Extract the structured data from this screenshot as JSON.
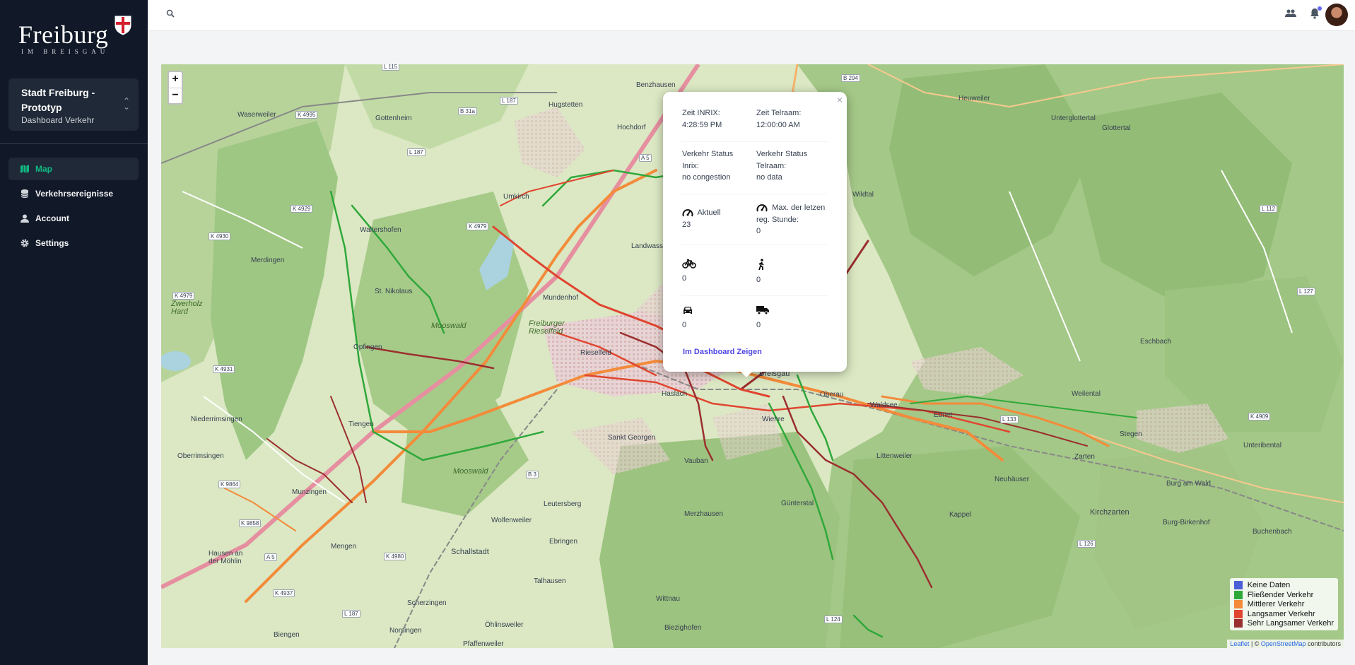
{
  "logo": {
    "word": "Freiburg",
    "sub": "IM BREISGAU"
  },
  "org": {
    "name": "Stadt Freiburg - Prototyp",
    "sub": "Dashboard Verkehr"
  },
  "nav": [
    {
      "label": "Map",
      "icon": "map-icon",
      "active": true
    },
    {
      "label": "Verkehrsereignisse",
      "icon": "database-icon"
    },
    {
      "label": "Account",
      "icon": "user-icon"
    },
    {
      "label": "Settings",
      "icon": "gear-icon"
    }
  ],
  "map": {
    "zoom_in": "+",
    "zoom_out": "−",
    "labels": {
      "benzhausen": "Benzhausen",
      "hochdorf": "Hochdorf",
      "gottenheim": "Gottenheim",
      "waserweiler": "Waserweiler",
      "hugstetten": "Hugstetten",
      "umkirch": "Umkirch",
      "merdingen": "Merdingen",
      "waltershofen": "Waltershofen",
      "landwasser": "Landwasser",
      "st_nikolaus": "St. Nikolaus",
      "mundenhof": "Mundenhof",
      "mooswald": "Mooswald",
      "opfingen": "Opfingen",
      "rieselfeld": "Rieselfeld",
      "freiburger_rieselfeld": "Freiburger Rieselfeld",
      "breisgau": "Breisgau",
      "haslach": "Haslach",
      "oberau": "Oberau",
      "waldsee": "Waldsee",
      "ebnet": "Ebnet",
      "wiehre": "Wiehre",
      "niederrimsingen": "Niederrimsingen",
      "tiengen": "Tiengen",
      "oberrimsingen": "Oberrimsingen",
      "st_georgen": "Sankt Georgen",
      "vauban": "Vauban",
      "littenweiler": "Littenweiler",
      "mooswald2": "Mooswald",
      "munzingen": "Munzingen",
      "leutersberg": "Leutersberg",
      "wolfenweiler": "Wolfenweiler",
      "merzhausen": "Merzhausen",
      "gunterstal": "Günterstal",
      "kappel": "Kappel",
      "zarten": "Zarten",
      "kirchzarten": "Kirchzarten",
      "neuhauser": "Neuhäuser",
      "mengen": "Mengen",
      "schallstadt": "Schallstadt",
      "ebringen": "Ebringen",
      "hausen": "Hausen an der Möhlin",
      "wittnau": "Wittnau",
      "talhausen": "Talhausen",
      "biezighofen": "Biezighofen",
      "bergen": "Biengen",
      "norsingen": "Norsingen",
      "pfaffenweiler": "Pfaffenweiler",
      "scherzingen": "Scherzingen",
      "ohlinsweiler": "Öhlinsweiler",
      "eschbach": "Eschbach",
      "stegen": "Stegen",
      "unteribental": "Unteribental",
      "burg_am_wald": "Burg am Wald",
      "burg_birkenhof": "Burg-Birkenhof",
      "buchenbach": "Buchenbach",
      "heuweiler": "Heuweiler",
      "unterglottertal": "Unterglottertal",
      "glottertal": "Glottertal",
      "wildtal": "Wildtal",
      "weilental": "Weilental",
      "zweierholz": "Zwerholz Hard"
    },
    "roads": {
      "l115": "L 115",
      "b294": "B 294",
      "b31a": "B 31a",
      "l187": "L 187",
      "k4995": "K 4995",
      "a5": "A 5",
      "k4929": "K 4929",
      "k4930": "K 4930",
      "k4979": "K 4979",
      "k4979b": "K 4979",
      "k4931": "K 4931",
      "l187b": "L 187",
      "b3": "B 3",
      "k4980": "K 4980",
      "k4937": "K 4937",
      "l187c": "L 187",
      "l124": "L 124",
      "l126": "L 126",
      "l133": "L 133",
      "k4909": "K 4909",
      "l112": "L 112",
      "l127": "L 127",
      "a5b": "A 5",
      "k9864": "K 9864",
      "k9858": "K 9858"
    }
  },
  "popup": {
    "close": "×",
    "zeit_inrix_label": "Zeit INRIX:",
    "zeit_inrix_value": "4:28:59 PM",
    "zeit_telraam_label": "Zeit Telraam:",
    "zeit_telraam_value": "12:00:00 AM",
    "status_inrix_label": "Verkehr Status Inrix:",
    "status_inrix_value": "no congestion",
    "status_telraam_label": "Verkehr Status Telraam:",
    "status_telraam_value": "no data",
    "aktuell_label": "Aktuell",
    "aktuell_value": "23",
    "max_label": "Max. der letzen reg. Stunde:",
    "max_value": "0",
    "bike_value": "0",
    "pedestrian_value": "0",
    "car_value": "0",
    "truck_value": "0",
    "link": "Im Dashboard Zeigen"
  },
  "legend": [
    {
      "label": "Keine Daten",
      "color": "#4b5ed6"
    },
    {
      "label": "Fließender Verkehr",
      "color": "#2fa83a"
    },
    {
      "label": "Mittlerer Verkehr",
      "color": "#f38b3a"
    },
    {
      "label": "Langsamer Verkehr",
      "color": "#e0452f"
    },
    {
      "label": "Sehr Langsamer Verkehr",
      "color": "#9b2f2f"
    }
  ],
  "attribution": {
    "leaflet": "Leaflet",
    "sep": " | © ",
    "osm": "OpenStreetMap",
    "suffix": " contributors"
  }
}
